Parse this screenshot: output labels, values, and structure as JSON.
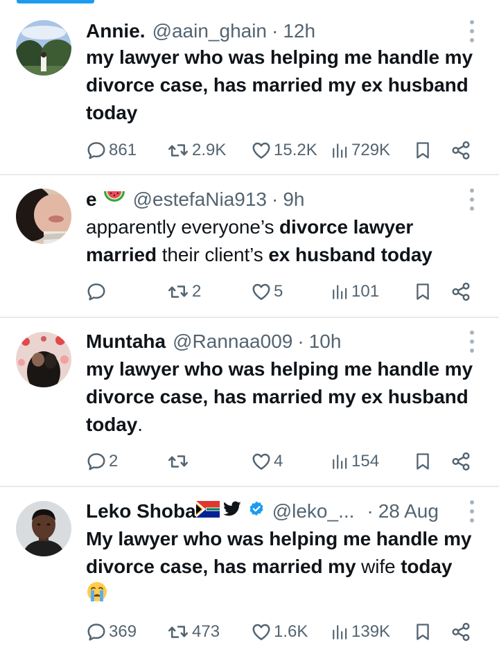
{
  "tweets": [
    {
      "name": "Annie.",
      "handle": "@aain_ghain",
      "time": "12h",
      "text": "my lawyer who was helping me handle my divorce case, has married my ex husband today",
      "replies": "861",
      "retweets": "2.9K",
      "likes": "15.2K",
      "views": "729K"
    },
    {
      "name": "e",
      "name_emoji": "watermelon-emoji",
      "handle": "@estefaNia913",
      "time": "9h",
      "text_parts": [
        "apparently everyone’s ",
        "divorce lawyer married",
        " their client’s ",
        "ex husband today"
      ],
      "replies": "",
      "retweets": "2",
      "likes": "5",
      "views": "101"
    },
    {
      "name": "Muntaha",
      "handle": "@Rannaa009",
      "time": "10h",
      "text": "my lawyer who was helping me handle my divorce case, has married my ex husband today",
      "text_end": ".",
      "replies": "2",
      "retweets": "",
      "likes": "4",
      "views": "154"
    },
    {
      "name": "Leko Shoba",
      "name_emojis": [
        "south-africa-flag-emoji",
        "bird-emoji"
      ],
      "verified": true,
      "handle": "@leko_...",
      "time": "28 Aug",
      "text_bold": "My lawyer who was helping me handle my divorce case, has married my",
      "text_normal": " wife",
      "text_bold2": "today",
      "text_emoji": "crying-face-emoji",
      "replies": "369",
      "retweets": "473",
      "likes": "1.6K",
      "views": "139K"
    }
  ],
  "separator": "·",
  "colors": {
    "accent": "#1d9bf0",
    "text": "#0f1419",
    "muted": "#536471",
    "divider": "#e7e9ec"
  },
  "icons": [
    "reply-icon",
    "retweet-icon",
    "like-icon",
    "views-icon",
    "bookmark-icon",
    "share-icon",
    "more-icon"
  ]
}
